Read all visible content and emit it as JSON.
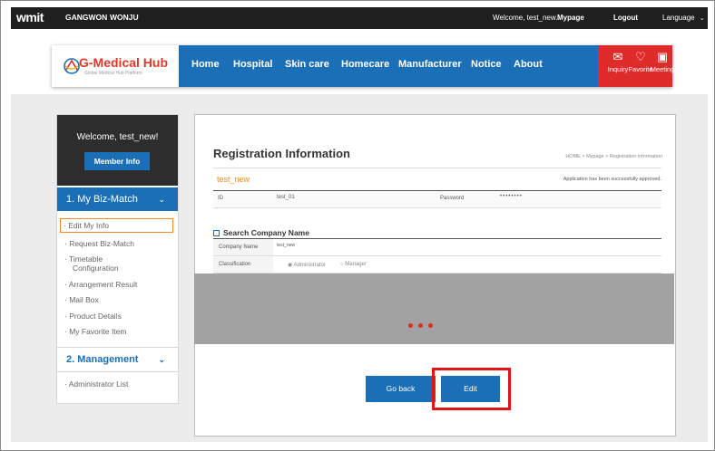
{
  "topbar": {
    "logo": "wmit",
    "region1": "GANGWON",
    "region2": "WONJU",
    "welcome": "Welcome, test_new.",
    "mypage": "Mypage",
    "logout": "Logout",
    "language": "Language"
  },
  "header": {
    "brand_name": "G-Medical Hub",
    "brand_sub": "Global Medical Hub Platform",
    "nav": [
      "Home",
      "Hospital",
      "Skin care",
      "Homecare",
      "Manufacturer",
      "Notice",
      "About"
    ],
    "quick": [
      {
        "label": "Inquiry",
        "icon": "mail-icon"
      },
      {
        "label": "Favorite",
        "icon": "heart-icon"
      },
      {
        "label": "Meeting",
        "icon": "video-meeting-icon"
      }
    ]
  },
  "sidebar": {
    "welcome": "Welcome, test_new!",
    "member_info": "Member Info",
    "section1": "1. My Biz-Match",
    "items1": [
      "· Edit My Info",
      "· Request Biz-Match",
      "· Timetable",
      "Configuration",
      "· Arrangement Result",
      "· Mail Box",
      "· Product Details",
      "· My Favorite Item"
    ],
    "section2": "2. Management",
    "items2": [
      "· Administrator List"
    ]
  },
  "panel": {
    "title": "Registration Information",
    "breadcrumb": "HOME > Mypage > Registration information",
    "user": "test_new",
    "approved": "Application has been successfully approved.",
    "id_label": "ID",
    "id_value": "test_01",
    "password_label": "Password",
    "password_value": "••••••••",
    "search_section": "Search Company Name",
    "company_label": "Company Name",
    "company_value": "test_new",
    "classification_label": "Classification",
    "option_admin": "Administrator",
    "option_manager": "Manager",
    "go_back": "Go back",
    "edit": "Edit"
  },
  "colors": {
    "accent_blue": "#1a6fb6",
    "brand_red": "#e02b2b",
    "active_orange": "#f08a24",
    "highlight_red": "#e01616"
  }
}
